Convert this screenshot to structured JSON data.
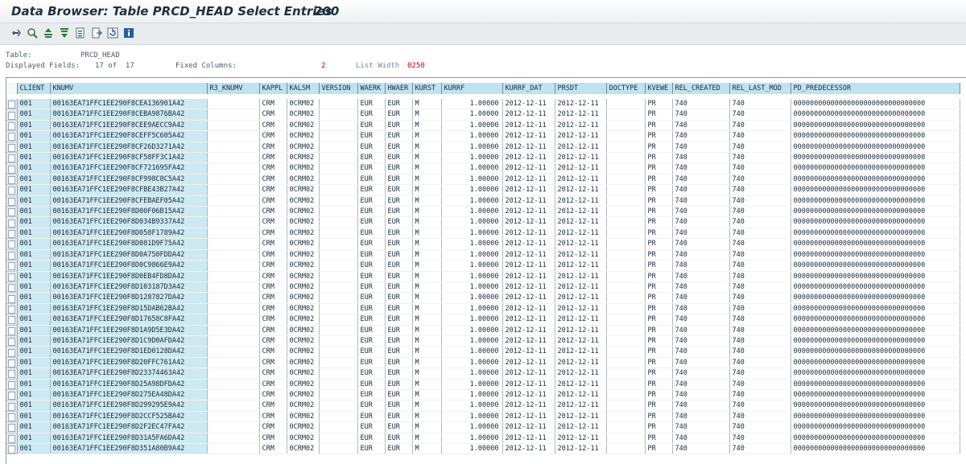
{
  "title": {
    "text": "Data Browser: Table PRCD_HEAD Select Entries",
    "count": "200"
  },
  "toolbar": {
    "buttons": [
      {
        "name": "check-entry-icon"
      },
      {
        "name": "details-icon"
      },
      {
        "name": "sort-ascending-icon"
      },
      {
        "name": "sort-descending-icon"
      },
      {
        "name": "filter-icon"
      },
      {
        "name": "export-icon"
      },
      {
        "name": "refresh-icon"
      },
      {
        "name": "info-icon"
      }
    ]
  },
  "info": {
    "table_label": "Table:",
    "table_value": "PRCD_HEAD",
    "displayed_label": "Displayed Fields:",
    "displayed_value": "17 of  17",
    "fixed_label": "Fixed Columns:",
    "fixed_value": "2",
    "width_label": "List Width",
    "width_value": "0250"
  },
  "columns": [
    "CLIENT",
    "KNUMV",
    "R3_KNUMV",
    "KAPPL",
    "KALSM",
    "VERSION",
    "WAERK",
    "HWAER",
    "KURST",
    "KURRF",
    "KURRF_DAT",
    "PRSDT",
    "DOCTYPE",
    "KVEWE",
    "REL_CREATED",
    "REL_LAST_MOD",
    "PD_PREDECESSOR"
  ],
  "row_defaults": {
    "client": "001",
    "r3_knumv": "",
    "kappl": "CRM",
    "kalsm": "0CRM02",
    "version": "",
    "waerk": "EUR",
    "hwaer": "EUR",
    "kurst": "M",
    "kurrf": "1.00000",
    "kurrf_dat": "2012-12-11",
    "prsdt": "2012-12-11",
    "doctype": "",
    "kvewe": "PR",
    "rel_created": "740",
    "rel_last_mod": "740",
    "pd_predecessor": "00000000000000000000000000000000"
  },
  "rows": [
    "00163EA71FFC1EE290F8CEA136901A42",
    "00163EA71FFC1EE290F8CEBA9876BA42",
    "00163EA71FFC1EE290F8CEE9AECC9A42",
    "00163EA71FFC1EE290F8CEFF5C605A42",
    "00163EA71FFC1EE290F8CF26D3271A42",
    "00163EA71FFC1EE290F8CF58FF3C1A42",
    "00163EA71FFC1EE290F8CF721695FA42",
    "00163EA71FFC1EE290F8CF998C8C5A42",
    "00163EA71FFC1EE290F8CFBE43B27A42",
    "00163EA71FFC1EE290F8CFEBAEF05A42",
    "00163EA71FFC1EE290F8D00F06B15A42",
    "00163EA71FFC1EE290F8D034B9337A42",
    "00163EA71FFC1EE290F8D058F1789A42",
    "00163EA71FFC1EE290F8D081D9F75A42",
    "00163EA71FFC1EE290F8D0A750FDDA42",
    "00163EA71FFC1EE290F8D0C9866E9A42",
    "00163EA71FFC1EE290F8D0EB4FD8DA42",
    "00163EA71FFC1EE290F8D103187D3A42",
    "00163EA71FFC1EE290F8D1287827DA42",
    "00163EA71FFC1EE290F8D15DAB62BA42",
    "00163EA71FFC1EE290F8D17658C8FA42",
    "00163EA71FFC1EE290F8D1A9D5E3DA42",
    "00163EA71FFC1EE290F8D1C9D0AFDA42",
    "00163EA71FFC1EE290F8D1ED0128DA42",
    "00163EA71FFC1EE290F8D20FFC761A42",
    "00163EA71FFC1EE290F8D23374463A42",
    "00163EA71FFC1EE290F8D25A98DFDA42",
    "00163EA71FFC1EE290F8D275EA48DA42",
    "00163EA71FFC1EE290F8D299295E9A42",
    "00163EA71FFC1EE290F8D2CCF525BA42",
    "00163EA71FFC1EE290F8D2F2EC47FA42",
    "00163EA71FFC1EE290F8D31A5FA6DA42",
    "00163EA71FFC1EE290F8D351A80B9A42"
  ],
  "colors": {
    "header_bg": "#bfe3ef",
    "key_bg": "#cde9f1",
    "info_text": "#4a5a6e",
    "accent_red": "#c00000"
  }
}
